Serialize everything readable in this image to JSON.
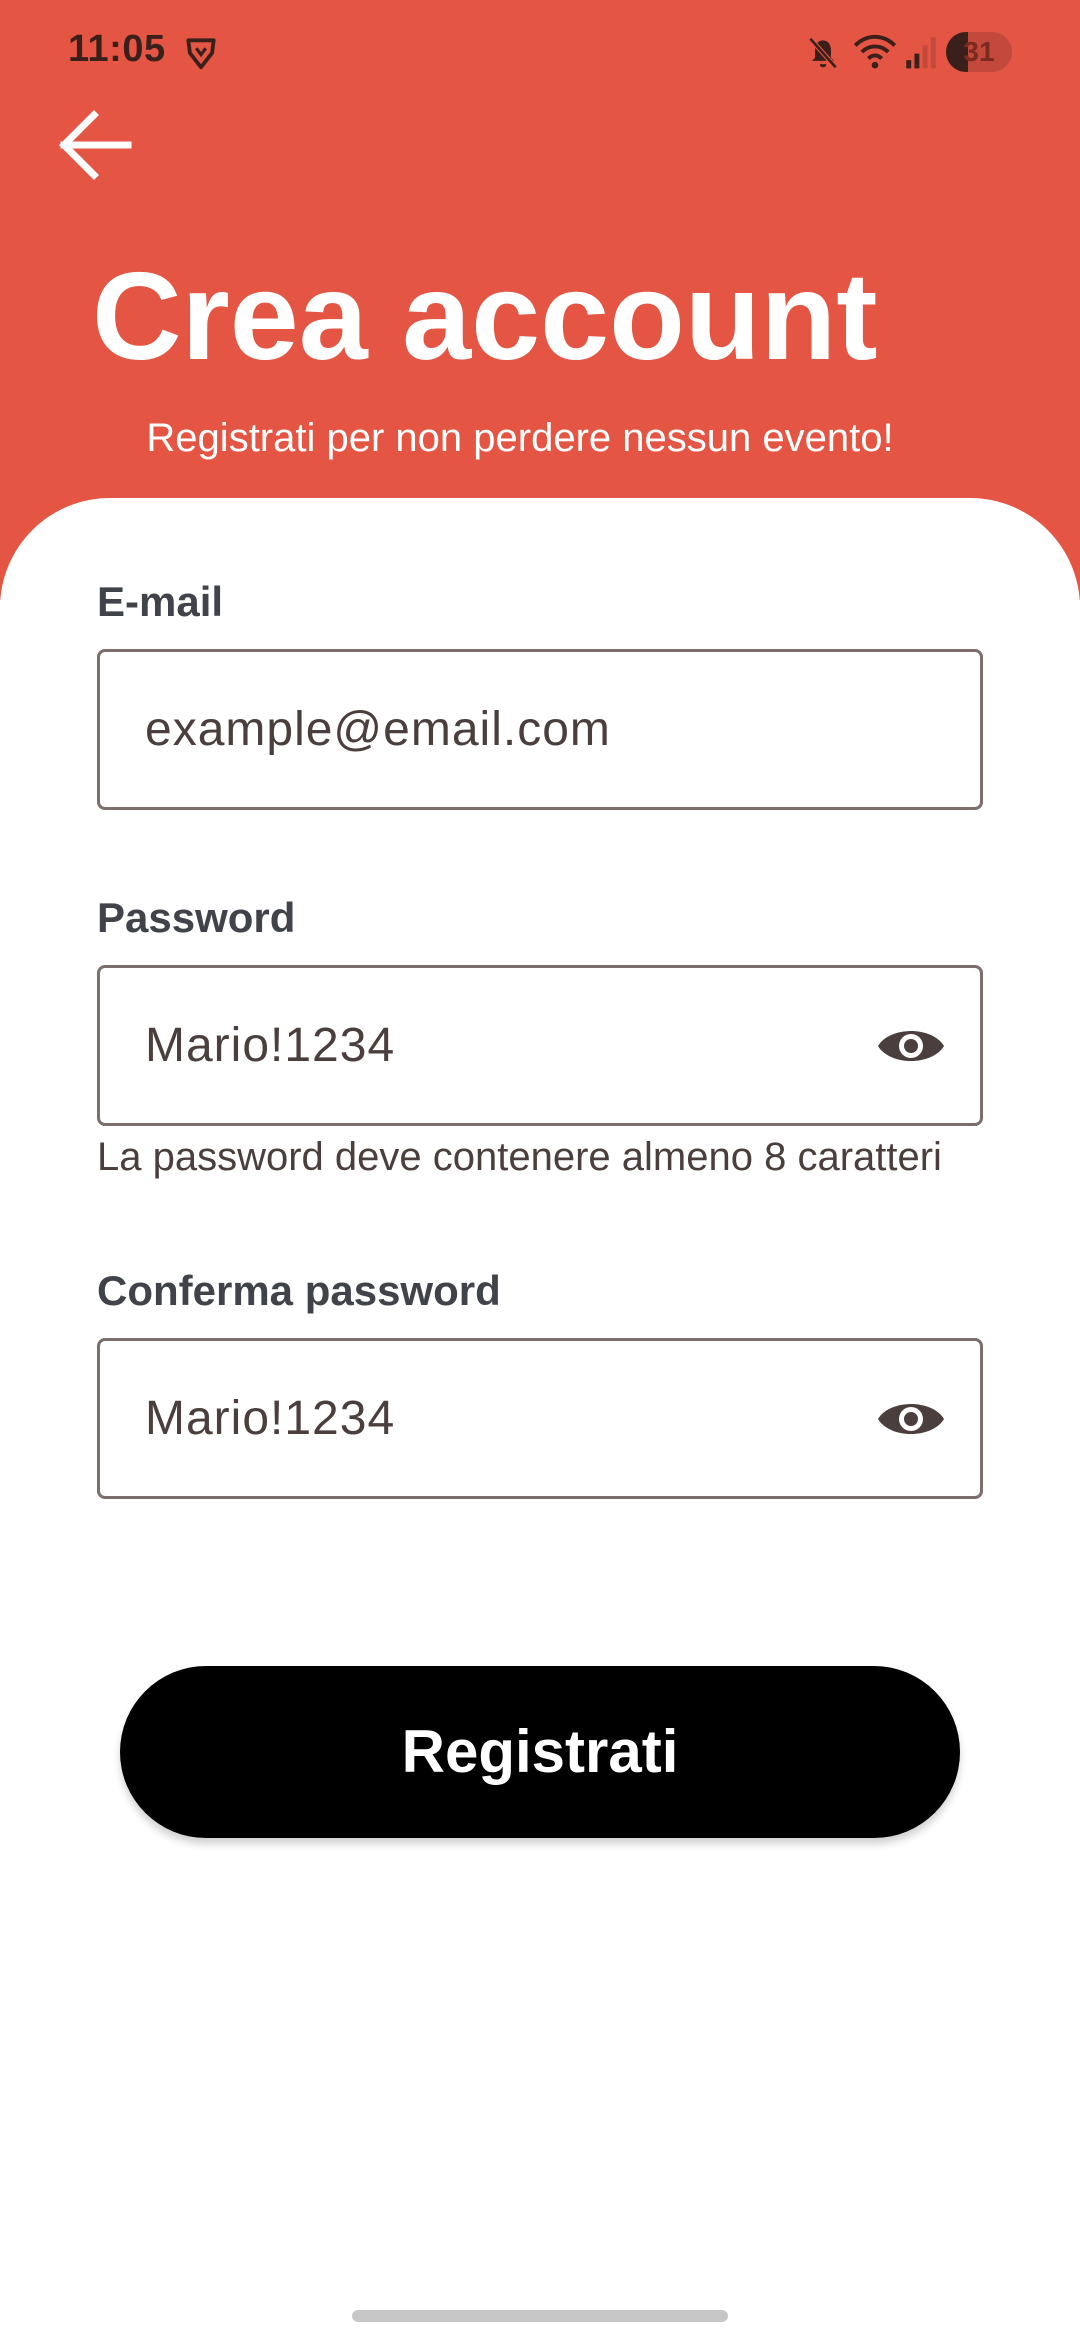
{
  "status_bar": {
    "time": "11:05",
    "battery": "31",
    "icons": [
      "brave-icon",
      "mute-icon",
      "wifi-icon",
      "signal-icon",
      "battery-icon"
    ]
  },
  "header": {
    "title": "Crea account",
    "subtitle": "Registrati per non perdere nessun evento!",
    "back_icon": "back-arrow-icon"
  },
  "form": {
    "email": {
      "label": "E-mail",
      "placeholder": "example@email.com"
    },
    "password": {
      "label": "Password",
      "value": "Mario!1234",
      "helper": "La password deve contenere almeno 8 caratteri",
      "toggle_icon": "eye-icon"
    },
    "confirm_password": {
      "label": "Conferma password",
      "value": "Mario!1234",
      "toggle_icon": "eye-icon"
    },
    "submit_label": "Registrati"
  },
  "colors": {
    "accent": "#e45543",
    "button": "#000000",
    "label": "#404349",
    "field_border": "#7c6f6b",
    "text": "#4a3f3c"
  }
}
